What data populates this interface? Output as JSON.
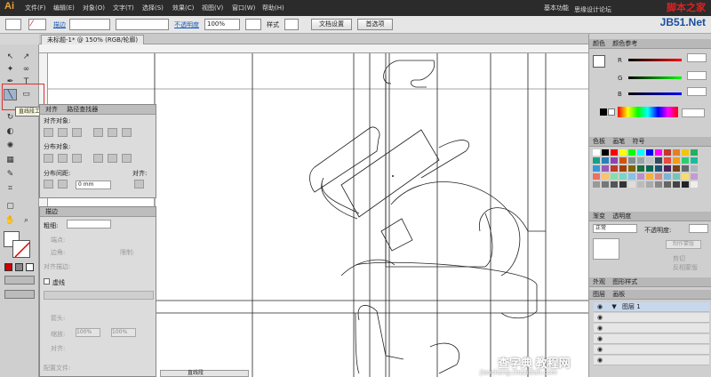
{
  "app": {
    "logo": "Ai",
    "workspace": "基本功能",
    "watermark_text": "思缘设计论坛",
    "watermark_site": "脚本之家",
    "watermark_site2": "JB51.Net",
    "watermark_bottom": "查字典 教程网",
    "watermark_bottom_url": "jiaocheng.chazidian.com"
  },
  "menu": [
    "文件(F)",
    "编辑(E)",
    "对象(O)",
    "文字(T)",
    "选择(S)",
    "效果(C)",
    "视图(V)",
    "窗口(W)",
    "帮助(H)"
  ],
  "control": {
    "stroke_label": "描边",
    "opacity_label": "不透明度",
    "opacity_value": "100%",
    "style_label": "样式",
    "doc_setup": "文档设置",
    "prefs": "首选项"
  },
  "document": {
    "tab": "未标题-1* @ 150% (RGB/轮廓)",
    "status": "直线段"
  },
  "tooltip": "直线段工具 (\\)",
  "pathfinder": {
    "tab1": "对齐",
    "tab2": "路径查找器",
    "align_objects": "对齐对象:",
    "distribute_objects": "分布对象:",
    "distribute_spacing": "分布间距:",
    "align_to": "对齐:",
    "spacing_value": "0 mm"
  },
  "stroke": {
    "tab": "描边",
    "weight_label": "粗细:",
    "cap": "端点:",
    "corner": "边角:",
    "limit": "限制:",
    "align": "对齐描边:",
    "dashed": "虚线",
    "arrow_start": "箭头:",
    "scale": "缩放:",
    "scale1": "100%",
    "scale2": "100%",
    "align2": "对齐:",
    "profile": "配置文件:"
  },
  "color": {
    "tab1": "颜色",
    "tab2": "颜色参考",
    "r": "R",
    "g": "G",
    "b": "B"
  },
  "swatches": {
    "tab1": "色板",
    "tab2": "画笔",
    "tab3": "符号"
  },
  "transparency": {
    "tab1": "渐变",
    "tab2": "透明度",
    "mode": "正常",
    "opacity_label": "不透明度:",
    "make_mask": "制作蒙版",
    "clip": "剪切",
    "invert": "反相蒙版"
  },
  "layers": {
    "tab1": "外观",
    "tab2": "图形样式",
    "tab3": "图层",
    "tab4": "画板",
    "layer1": "图层 1"
  },
  "swatch_colors": [
    "#ffffff",
    "#000000",
    "#ff0000",
    "#ffff00",
    "#00ff00",
    "#00ffff",
    "#0000ff",
    "#ff00ff",
    "#c0392b",
    "#e67e22",
    "#f1c40f",
    "#27ae60",
    "#16a085",
    "#2980b9",
    "#8e44ad",
    "#d35400",
    "#7f8c8d",
    "#95a5a6",
    "#bdc3c7",
    "#34495e",
    "#e74c3c",
    "#f39c12",
    "#2ecc71",
    "#1abc9c",
    "#3498db",
    "#9b59b6",
    "#c0392b",
    "#a04000",
    "#7d6608",
    "#196f3d",
    "#0e6655",
    "#1a5276",
    "#4a235a",
    "#784212",
    "#616a6b",
    "#aeb6bf",
    "#ec7063",
    "#f8c471",
    "#82e0aa",
    "#76d7c4",
    "#85c1e9",
    "#bb8fce",
    "#f5b041",
    "#d98880",
    "#7fb3d5",
    "#73c6b6",
    "#f7dc6f",
    "#c39bd3",
    "#999999",
    "#777777",
    "#555555",
    "#333333",
    "#dddddd",
    "#bbbbbb",
    "#aaaaaa",
    "#888888",
    "#666666",
    "#444444",
    "#222222",
    "#eeeeee"
  ]
}
